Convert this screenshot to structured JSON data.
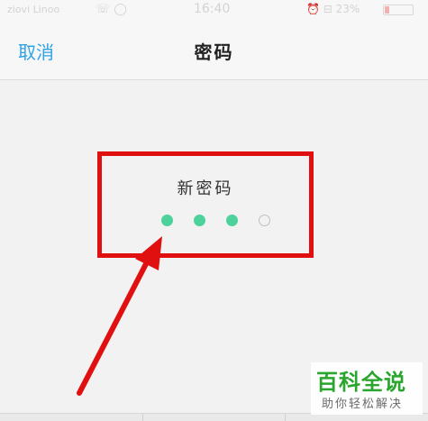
{
  "status_bar": {
    "carrier": "ziovi Linoo",
    "left_icons": "☏ ◯",
    "time": "16:40",
    "right_icons": "⏰ ⊟ 23%",
    "battery_level": 0.15
  },
  "nav": {
    "cancel_label": "取消",
    "title": "密码"
  },
  "passcode": {
    "label": "新密码",
    "digits_entered": 3,
    "digits_total": 4
  },
  "watermark": {
    "title": "百科全说",
    "subtitle": "助你轻松解决"
  },
  "colors": {
    "accent_blue": "#2ea3e6",
    "dot_green": "#4cd29a",
    "annotation_red": "#e01010",
    "watermark_green": "#2aa52e"
  }
}
